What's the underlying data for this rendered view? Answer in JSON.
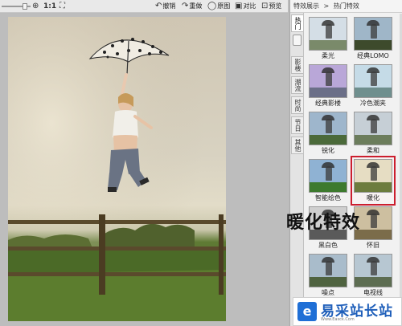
{
  "toolbar": {
    "zoom_in_icon": "zoom-in-icon",
    "actual_size": "1:1",
    "fit_icon": "fit-screen-icon",
    "undo": "撤销",
    "redo": "重做",
    "original": "原图",
    "compare": "对比",
    "preview": "预览"
  },
  "panel": {
    "breadcrumb": [
      "特效展示",
      ">",
      "热门特效"
    ],
    "tabs": [
      "热门",
      "影楼",
      "潮流",
      "时尚",
      "节日",
      "其他"
    ],
    "active_tab": "热门",
    "effects": [
      {
        "label": "柔光",
        "sky": "#d4dee6",
        "grass": "#7a8a6a"
      },
      {
        "label": "经典LOMO",
        "sky": "#9fb6c8",
        "grass": "#3d4a2c"
      },
      {
        "label": "经典影楼",
        "sky": "#b9a7d8",
        "grass": "#6b6f88"
      },
      {
        "label": "冷色潮夹",
        "sky": "#c5dbe7",
        "grass": "#6f8f8e"
      },
      {
        "label": "锐化",
        "sky": "#9eb6cc",
        "grass": "#4b6a3a"
      },
      {
        "label": "柔和",
        "sky": "#c6cfd6",
        "grass": "#6c7d5c"
      },
      {
        "label": "智能绘色",
        "sky": "#8fb2d3",
        "grass": "#3d7a2e"
      },
      {
        "label": "暖化",
        "sky": "#e6ddc3",
        "grass": "#6d7c3e"
      },
      {
        "label": "黑白色",
        "sky": "#cfcfcf",
        "grass": "#5a5a5a"
      },
      {
        "label": "怀旧",
        "sky": "#cdbfa0",
        "grass": "#7b6c4a"
      },
      {
        "label": "噪点",
        "sky": "#a9bccb",
        "grass": "#4f6340"
      },
      {
        "label": "电视线",
        "sky": "#b7c7d2",
        "grass": "#5d6d52"
      }
    ],
    "highlighted": "暖化"
  },
  "overlay_text": "暖化特效",
  "watermark": {
    "name": "易采站长站",
    "url": "Www.Easck.Com",
    "logo_glyph": "e"
  },
  "colors": {
    "highlight": "#cc1e2e",
    "brand_blue": "#1f6fd6"
  }
}
